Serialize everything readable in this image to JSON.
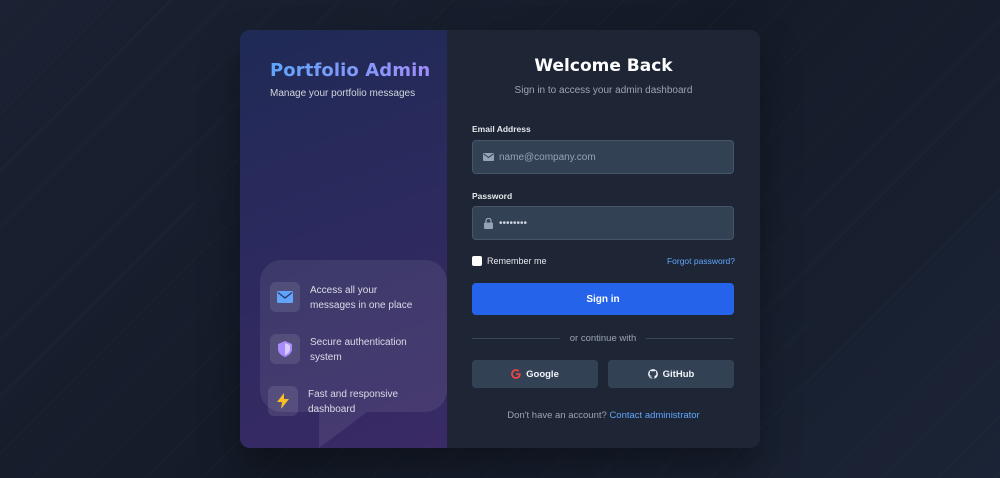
{
  "brand": {
    "title": "Portfolio Admin",
    "subtitle": "Manage your portfolio messages"
  },
  "features": [
    {
      "icon": "envelope-icon",
      "text": "Access all your messages in one place"
    },
    {
      "icon": "shield-icon",
      "text": "Secure authentication system"
    },
    {
      "icon": "lightning-icon",
      "text": "Fast and responsive dashboard"
    }
  ],
  "login": {
    "heading": "Welcome Back",
    "subheading": "Sign in to access your admin dashboard",
    "email_label": "Email Address",
    "email_placeholder": "name@company.com",
    "password_label": "Password",
    "password_value": "••••••••",
    "remember_label": "Remember me",
    "forgot_label": "Forgot password?",
    "signin_label": "Sign in",
    "divider_text": "or continue with",
    "google_label": "Google",
    "github_label": "GitHub",
    "footer_text": "Don't have an account?",
    "footer_link": "Contact administrator"
  },
  "colors": {
    "accent": "#2563eb",
    "link": "#60a5fa",
    "panel": "#1e2636",
    "input": "#334155"
  }
}
